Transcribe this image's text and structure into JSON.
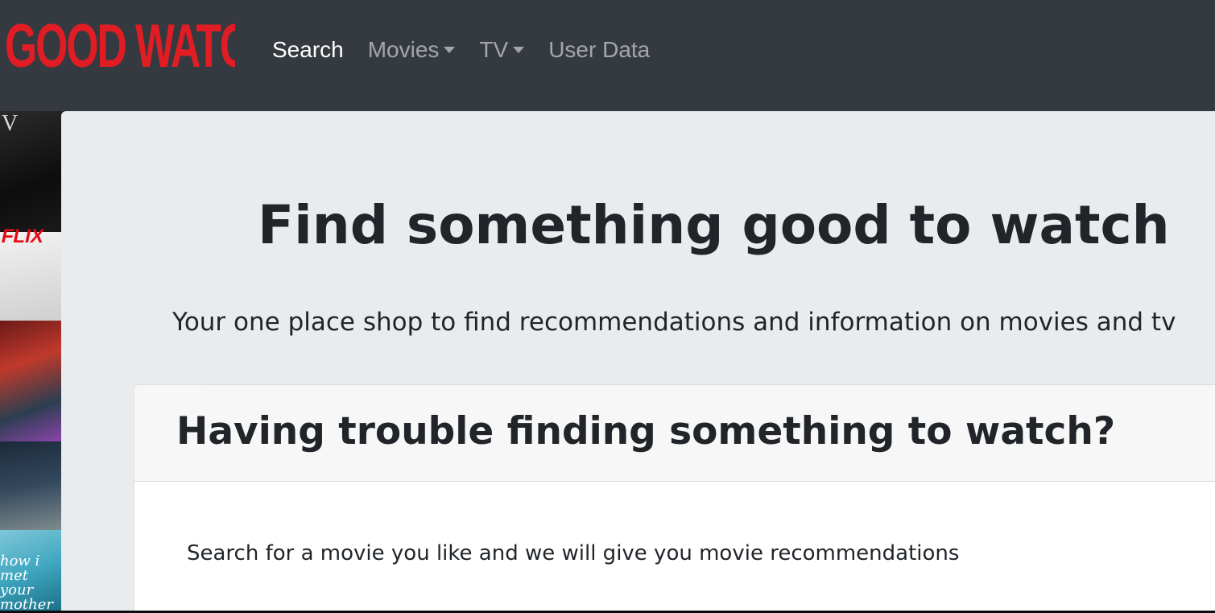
{
  "navbar": {
    "brand": "GOOD WATCHES",
    "links": [
      {
        "label": "Search",
        "active": true,
        "dropdown": false
      },
      {
        "label": "Movies",
        "active": false,
        "dropdown": true
      },
      {
        "label": "TV",
        "active": false,
        "dropdown": true
      },
      {
        "label": "User Data",
        "active": false,
        "dropdown": false
      }
    ],
    "background": "#343a40",
    "brand_color": "#e01c24"
  },
  "posters": {
    "letter_1": "V",
    "logo_text": "FLIX",
    "title_text": "how i met your mother"
  },
  "hero": {
    "title": "Find something good to watch",
    "subtitle": "Your one place shop to find recommendations and information on movies and tv"
  },
  "card": {
    "header": "Having trouble finding something to watch?",
    "body": "Search for a movie you like and we will give you movie recommendations"
  }
}
